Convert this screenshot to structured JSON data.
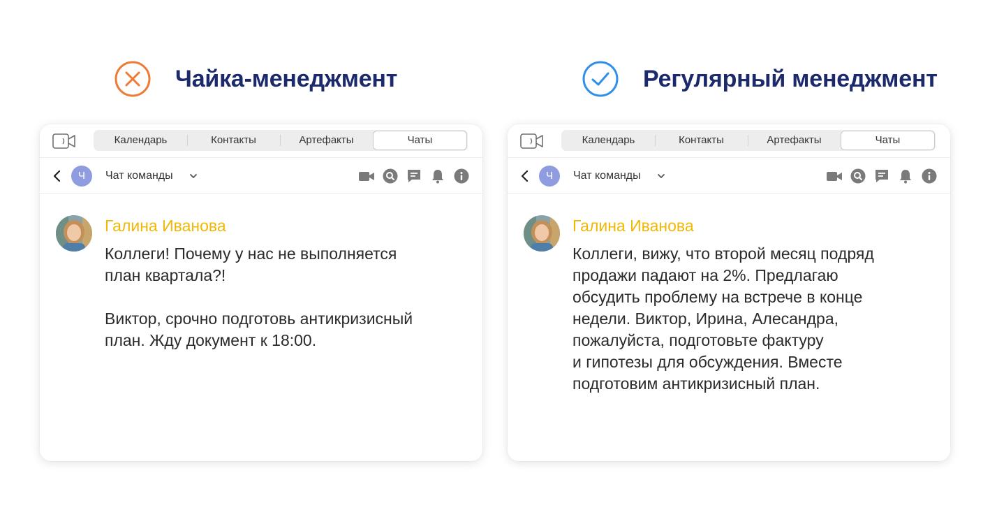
{
  "panels": {
    "left": {
      "title": "Чайка-менеджмент",
      "verdict_icon": "cross-circle-icon",
      "verdict_color": "#ee7a35",
      "tabs": [
        "Календарь",
        "Контакты",
        "Артефакты",
        "Чаты"
      ],
      "active_tab": "Чаты",
      "chat": {
        "avatar_letter": "Ч",
        "name": "Чат команды"
      },
      "message": {
        "author": "Галина Иванова",
        "paragraphs": [
          "Коллеги! Почему у нас не выполняется\nплан квартала?!",
          "Виктор, срочно подготовь антикризисный\nплан. Жду документ к 18:00."
        ]
      }
    },
    "right": {
      "title": "Регулярный менеджмент",
      "verdict_icon": "check-circle-icon",
      "verdict_color": "#2f8fea",
      "tabs": [
        "Календарь",
        "Контакты",
        "Артефакты",
        "Чаты"
      ],
      "active_tab": "Чаты",
      "chat": {
        "avatar_letter": "Ч",
        "name": "Чат команды"
      },
      "message": {
        "author": "Галина Иванова",
        "paragraphs": [
          "Коллеги, вижу, что второй месяц подряд\nпродажи падают на 2%. Предлагаю\nобсудить проблему на встрече в конце\nнедели. Виктор, Ирина, Алесандра,\nпожалуйста, подготовьте фактуру\nи гипотезы для обсуждения. Вместе\nподготовим антикризисный план."
        ]
      }
    }
  },
  "colors": {
    "heading": "#1c2a6b",
    "author": "#f2b705",
    "chat_avatar": "#8f9de0",
    "icon_gray": "#7a7a7a"
  },
  "icons": {
    "topbar": "video-call-icon",
    "back": "back-arrow-icon",
    "dropdown": "chevron-down-icon",
    "actions": [
      "video-icon",
      "search-icon",
      "chat-bubble-icon",
      "bell-icon",
      "info-icon"
    ]
  }
}
